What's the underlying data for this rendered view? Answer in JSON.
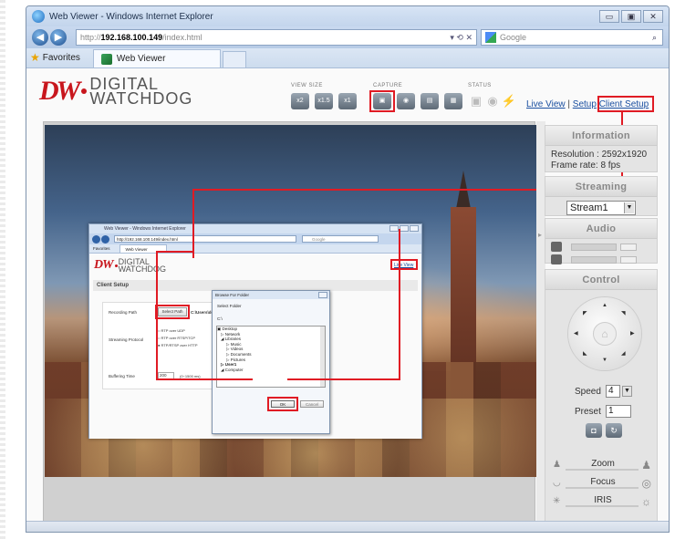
{
  "window": {
    "title": "Web Viewer - Windows Internet Explorer",
    "buttons": [
      "▭",
      "▣",
      "✕"
    ]
  },
  "nav": {
    "back": "◀",
    "forward": "▶",
    "address_proto": "http://",
    "address_host": "192.168.100.149",
    "address_path": "/index.html",
    "address_tools": "▾  ⟲  ✕",
    "search_placeholder": "Google",
    "search_icon": "⌕"
  },
  "tabs": {
    "favorites": "Favorites",
    "active_tab": "Web Viewer"
  },
  "app": {
    "logo_mark": "DW",
    "logo_text_1": "DIGITAL",
    "logo_text_2": "WATCHDOG",
    "toolbar": {
      "view_size_label": "VIEW SIZE",
      "capture_label": "CAPTURE",
      "status_label": "STATUS",
      "size_buttons": [
        "x2",
        "x1.5",
        "x1"
      ],
      "capture_buttons": [
        "▣",
        "◉",
        "▤",
        "▦"
      ],
      "status_icons": [
        "▣",
        "◉",
        "⚡"
      ]
    },
    "links": {
      "live_view": "Live View",
      "sep": " | ",
      "setup": "Setup",
      "client_setup": "Client Setup"
    },
    "right_panel": {
      "information_title": "Information",
      "resolution": "Resolution : 2592x1920",
      "frame_rate": "Frame rate: 8 fps",
      "streaming_title": "Streaming",
      "stream_value": "Stream1",
      "audio_title": "Audio",
      "control_title": "Control",
      "speed_label": "Speed",
      "speed_value": "4",
      "preset_label": "Preset",
      "preset_value": "1",
      "zoom_label": "Zoom",
      "focus_label": "Focus",
      "iris_label": "IRIS"
    }
  },
  "inner": {
    "title": "Web Viewer - Windows Internet Explorer",
    "address": "http://192.168.100.149/index.html",
    "search": "Google",
    "favorites": "Favorites",
    "tab": "Web Viewer",
    "live_view": "Live View",
    "section": "Client Setup",
    "recording_path_label": "Recording Path",
    "select_path_button": "Select Path",
    "path_value": "C:\\Users\\debbing.DIGITALWATCHDOG\\Desktop",
    "streaming_protocol_label": "Streaming Protocol",
    "protocols": [
      "RTP over UDP",
      "RTP over RTSP/TCP",
      "RTP/RTSP over HTTP"
    ],
    "buffering_label": "Buffering Time",
    "buffering_value": "200",
    "buffering_hint": "(0~1500 ms)",
    "browse": {
      "title": "Browse For Folder",
      "caption": "Select Folder",
      "current": "C:\\",
      "tree": [
        "Desktop",
        "Network",
        "Libraries",
        "Music",
        "Videos",
        "Documents",
        "Pictures",
        "User1",
        "Computer"
      ],
      "ok": "OK",
      "cancel": "Cancel"
    }
  }
}
